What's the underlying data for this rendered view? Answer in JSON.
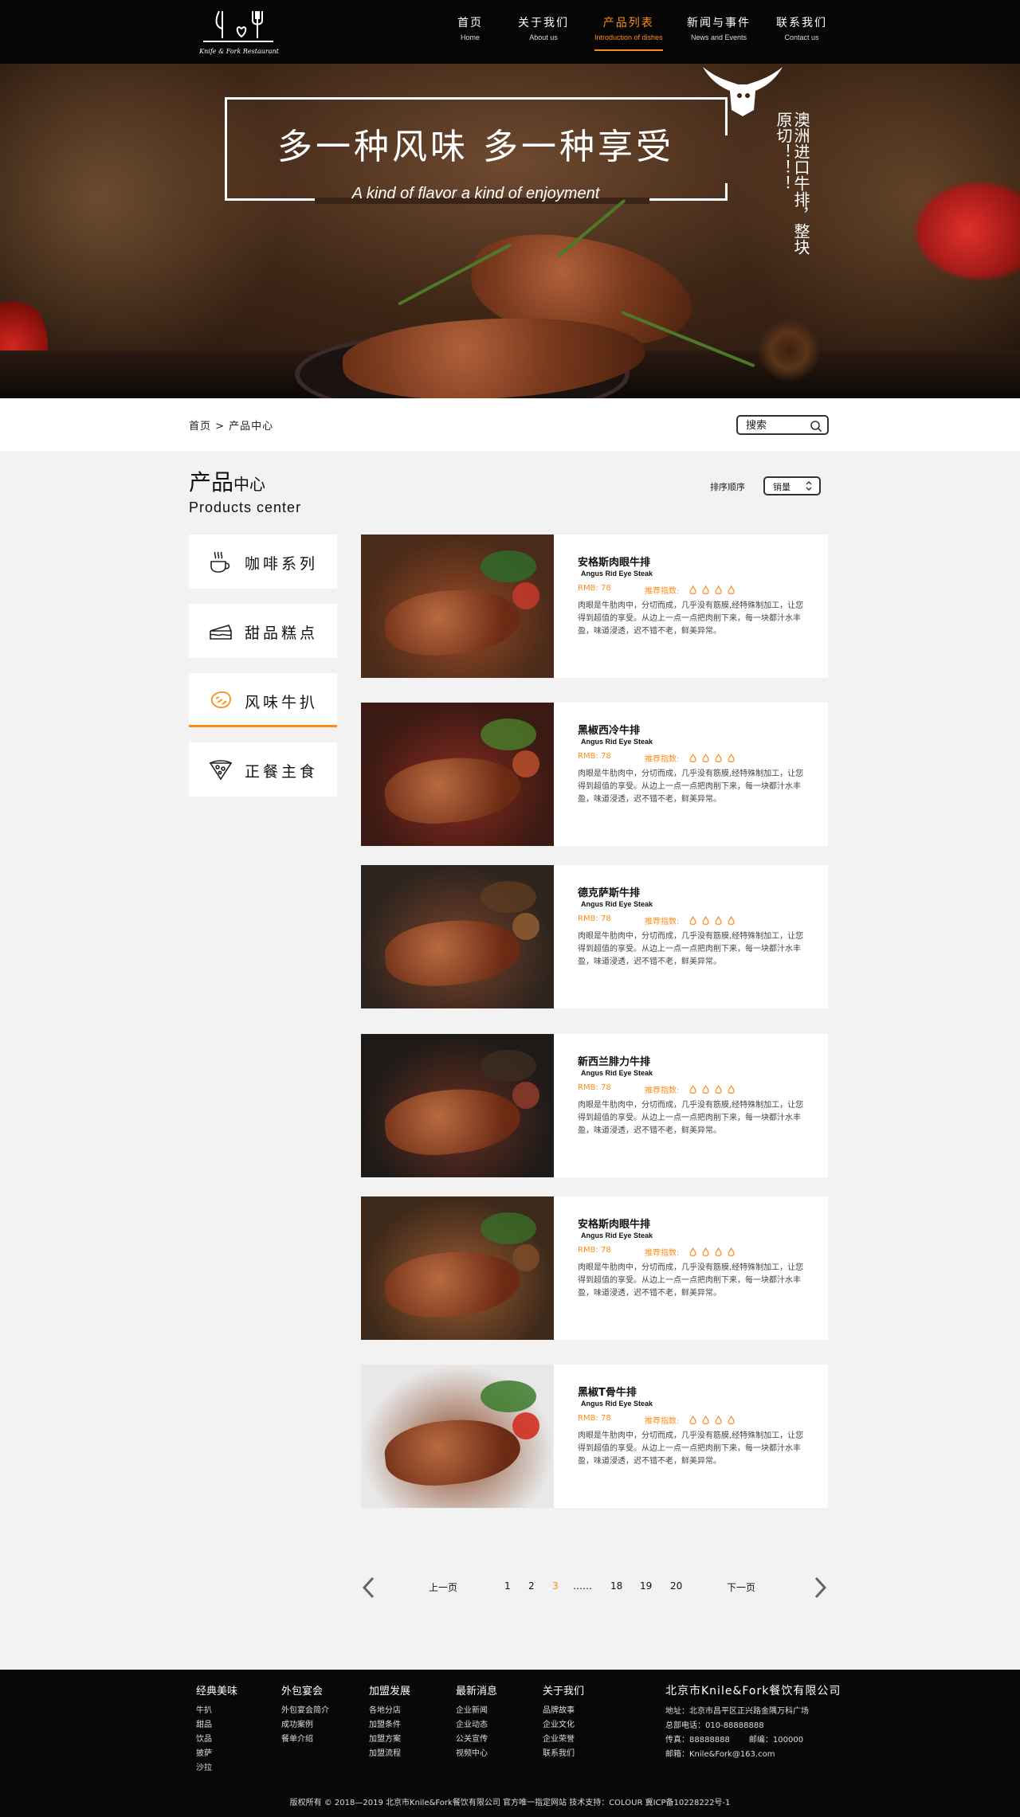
{
  "header": {
    "logo_text": "Knife & Fork Restaurant",
    "nav": [
      {
        "cn": "首页",
        "en": "Home"
      },
      {
        "cn": "关于我们",
        "en": "About us"
      },
      {
        "cn": "产品列表",
        "en": "Introduction of dishes"
      },
      {
        "cn": "新闻与事件",
        "en": "News and Events"
      },
      {
        "cn": "联系我们",
        "en": "Contact us"
      }
    ],
    "active_index": 2,
    "accent_color": "#ff8c1a"
  },
  "hero": {
    "title": "多一种风味  多一种享受",
    "subtitle": "A kind of flavor  a kind of enjoyment",
    "vertical_text": "澳洲进口牛排，整块原切！！！"
  },
  "breadcrumb": {
    "text": "首页 > 产品中心"
  },
  "search": {
    "placeholder": "搜索"
  },
  "section": {
    "title_big": "产品",
    "title_small": "中心",
    "subtitle": "Products center",
    "sort_label": "排序顺序",
    "sort_value": "销量"
  },
  "sidebar": {
    "items": [
      {
        "label": "咖啡系列",
        "icon": "coffee-icon"
      },
      {
        "label": "甜品糕点",
        "icon": "cake-icon"
      },
      {
        "label": "风味牛扒",
        "icon": "steak-icon"
      },
      {
        "label": "正餐主食",
        "icon": "pizza-icon"
      }
    ],
    "active_index": 2
  },
  "products": [
    {
      "name": "安格斯肉眼牛排",
      "en": "Angus Rid Eye Steak",
      "price": "RMB: 78",
      "rec_label": "推荐指数:",
      "rating": 4,
      "desc": "肉眼是牛肋肉中，分切而成，几乎没有筋膜,经特殊制加工，让您得到超值的享受。从边上一点一点把肉削下来，每一块都汁水丰盈，味道浸透，迟不错不老，鲜美异常。"
    },
    {
      "name": "黑椒西冷牛排",
      "en": "Angus Rid Eye Steak",
      "price": "RMB: 78",
      "rec_label": "推荐指数:",
      "rating": 4,
      "desc": "肉眼是牛肋肉中，分切而成，几乎没有筋膜,经特殊制加工，让您得到超值的享受。从边上一点一点把肉削下来，每一块都汁水丰盈，味道浸透，迟不错不老，鲜美异常。"
    },
    {
      "name": "德克萨斯牛排",
      "en": "Angus Rid Eye Steak",
      "price": "RMB: 78",
      "rec_label": "推荐指数:",
      "rating": 4,
      "desc": "肉眼是牛肋肉中，分切而成，几乎没有筋膜,经特殊制加工，让您得到超值的享受。从边上一点一点把肉削下来，每一块都汁水丰盈，味道浸透，迟不错不老，鲜美异常。"
    },
    {
      "name": "新西兰腓力牛排",
      "en": "Angus Rid Eye Steak",
      "price": "RMB: 78",
      "rec_label": "推荐指数:",
      "rating": 4,
      "desc": "肉眼是牛肋肉中，分切而成，几乎没有筋膜,经特殊制加工，让您得到超值的享受。从边上一点一点把肉削下来，每一块都汁水丰盈，味道浸透，迟不错不老，鲜美异常。"
    },
    {
      "name": "安格斯肉眼牛排",
      "en": "Angus Rid Eye Steak",
      "price": "RMB: 78",
      "rec_label": "推荐指数:",
      "rating": 4,
      "desc": "肉眼是牛肋肉中，分切而成，几乎没有筋膜,经特殊制加工，让您得到超值的享受。从边上一点一点把肉削下来，每一块都汁水丰盈，味道浸透，迟不错不老，鲜美异常。"
    },
    {
      "name": "黑椒T骨牛排",
      "en": "Angus Rid Eye Steak",
      "price": "RMB: 78",
      "rec_label": "推荐指数:",
      "rating": 4,
      "desc": "肉眼是牛肋肉中，分切而成，几乎没有筋膜,经特殊制加工，让您得到超值的享受。从边上一点一点把肉削下来，每一块都汁水丰盈，味道浸透，迟不错不老，鲜美异常。"
    }
  ],
  "pagination": {
    "prev": "上一页",
    "next": "下一页",
    "pages": [
      "1",
      "2",
      "3",
      "……",
      "18",
      "19",
      "20"
    ],
    "current": "3"
  },
  "footer": {
    "columns": [
      {
        "head": "经典美味",
        "links": [
          "牛扒",
          "甜品",
          "饮品",
          "披萨",
          "沙拉"
        ]
      },
      {
        "head": "外包宴会",
        "links": [
          "外包宴会简介",
          "成功案例",
          "餐单介绍"
        ]
      },
      {
        "head": "加盟发展",
        "links": [
          "各地分店",
          "加盟条件",
          "加盟方案",
          "加盟流程"
        ]
      },
      {
        "head": "最新消息",
        "links": [
          "企业新闻",
          "企业动态",
          "公关宣传",
          "视频中心"
        ]
      },
      {
        "head": "关于我们",
        "links": [
          "品牌故事",
          "企业文化",
          "企业荣誉",
          "联系我们"
        ]
      }
    ],
    "company": {
      "name": "北京市Knile&Fork餐饮有限公司",
      "address": "地址：北京市昌平区正兴路金隅万科广场",
      "phone": "总部电话：010-88888888",
      "fax": "传真：88888888",
      "postcode": "邮编：100000",
      "email": "邮箱：Knile&Fork@163.com"
    },
    "copyright": "版权所有 © 2018—2019 北京市Knile&Fork餐饮有限公司 官方唯一指定网站 技术支持：COLOUR   冀ICP备10228222号-1"
  }
}
